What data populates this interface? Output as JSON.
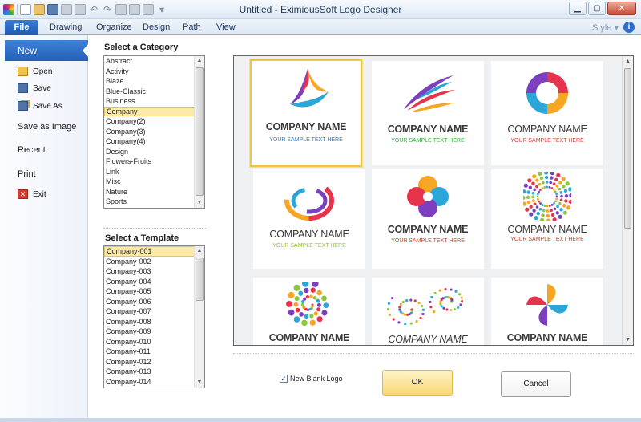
{
  "window": {
    "title": "Untitled - EximiousSoft Logo Designer"
  },
  "ribbon": {
    "tabs": [
      "File",
      "Drawing",
      "Organize",
      "Design",
      "Path",
      "View"
    ],
    "style_label": "Style",
    "help": "i"
  },
  "backstage": {
    "new": "New",
    "open": "Open",
    "save": "Save",
    "save_as": "Save As",
    "save_as_image": "Save as Image",
    "recent": "Recent",
    "print": "Print",
    "exit": "Exit"
  },
  "category": {
    "title": "Select a Category",
    "items": [
      "Abstract",
      "Activity",
      "Blaze",
      "Blue-Classic",
      "Business",
      "Company",
      "Company(2)",
      "Company(3)",
      "Company(4)",
      "Design",
      "Flowers-Fruits",
      "Link",
      "Misc",
      "Nature",
      "Sports"
    ],
    "selected": "Company"
  },
  "template": {
    "title": "Select a Template",
    "items": [
      "Company-001",
      "Company-002",
      "Company-003",
      "Company-004",
      "Company-005",
      "Company-006",
      "Company-007",
      "Company-008",
      "Company-009",
      "Company-010",
      "Company-011",
      "Company-012",
      "Company-013",
      "Company-014"
    ],
    "selected": "Company-001"
  },
  "gallery": {
    "tiles": [
      {
        "company": "COMPANY NAME",
        "sample": "YOUR SAMPLE TEXT HERE",
        "sample_color": "#2f7cc4",
        "icon": "triangle-swirl-icon"
      },
      {
        "company": "COMPANY NAME",
        "sample": "YOUR SAMPLE TEXT HERE",
        "sample_color": "#3aa23a",
        "icon": "wing-swoosh-icon"
      },
      {
        "company": "COMPANY NAME",
        "sample": "YOUR SAMPLE TEXT HERE",
        "sample_color": "#d23a2a",
        "icon": "circle-swirl-icon"
      },
      {
        "company": "COMPANY NAME",
        "sample": "YOUR SAMPLE TEXT HERE",
        "sample_color": "#9cc02a",
        "icon": "ring-swirl-icon"
      },
      {
        "company": "COMPANY NAME",
        "sample": "YOUR SAMPLE TEXT HERE",
        "sample_color": "#c8452a",
        "icon": "heart-flower-icon"
      },
      {
        "company": "COMPANY NAME",
        "sample": "YOUR SAMPLE TEXT HERE",
        "sample_color": "#d23a2a",
        "icon": "dot-burst-icon"
      },
      {
        "company": "COMPANY NAME",
        "sample": "",
        "sample_color": "#333333",
        "icon": "dot-spiral-icon"
      },
      {
        "company": "COMPANY NAME",
        "sample": "",
        "sample_color": "#333333",
        "icon": "dot-wave-icon"
      },
      {
        "company": "COMPANY NAME",
        "sample": "",
        "sample_color": "#333333",
        "icon": "pinwheel-icon"
      }
    ]
  },
  "options": {
    "new_blank_logo": "New Blank Logo",
    "checked": true
  },
  "buttons": {
    "ok": "OK",
    "cancel": "Cancel"
  }
}
